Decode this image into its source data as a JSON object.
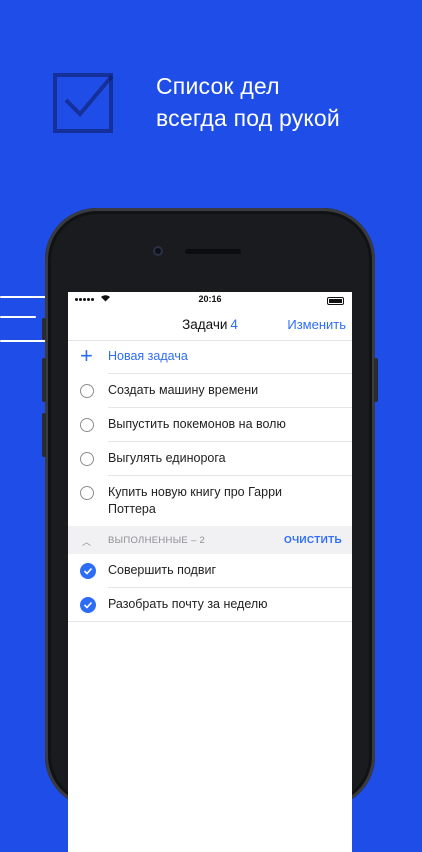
{
  "hero": {
    "icon": "checkbox-icon",
    "title_line1": "Список дел",
    "title_line2": "всегда под рукой"
  },
  "status_bar": {
    "time": "20:16"
  },
  "nav": {
    "title": "Задачи",
    "count": "4",
    "edit_label": "Изменить"
  },
  "new_task": {
    "icon": "plus-icon",
    "label": "Новая задача"
  },
  "tasks": [
    "Создать машину времени",
    "Выпустить покемонов на волю",
    "Выгулять единорога",
    "Купить новую книгу про Гарри Поттера"
  ],
  "completed_section": {
    "label": "ВЫПОЛНЕННЫЕ – 2",
    "clear_label": "ОЧИСТИТЬ",
    "icon": "chevron-up-icon"
  },
  "completed": [
    "Совершить подвиг",
    "Разобрать почту за неделю"
  ],
  "colors": {
    "background": "#1f4de8",
    "accent": "#2d6df6"
  }
}
